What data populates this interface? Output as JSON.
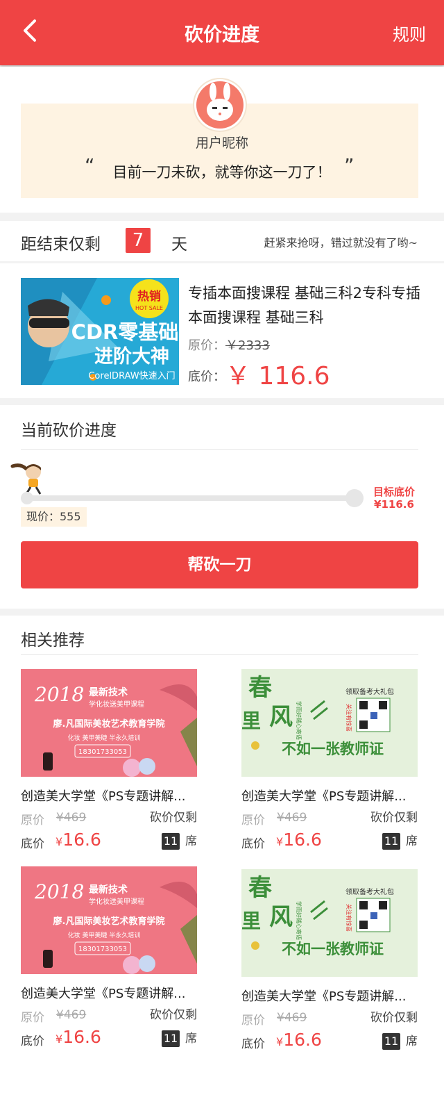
{
  "header": {
    "title": "砍价进度",
    "rules_label": "规则"
  },
  "user": {
    "nickname": "用户昵称",
    "slogan": "目前一刀未砍，就等你这一刀了！",
    "quote_open": "“",
    "quote_close": "”"
  },
  "timer": {
    "label": "距结束仅剩",
    "days": "7",
    "unit": "天",
    "hurry_text": "赶紧来抢呀，错过就没有了哟~"
  },
  "product": {
    "title": "专插本面搜课程 基础三科2专科专插本面搜课程  基础三科",
    "orig_label": "原价：",
    "orig_price": "￥2333",
    "floor_label": "底价：",
    "floor_price": "￥ 116.6",
    "image": {
      "badge_top": "热销",
      "badge_bottom": "HOT SALE",
      "line1": "CDR零基础",
      "line2": "进阶大神",
      "line3": "CorelDRAW快速入门"
    }
  },
  "progress": {
    "title": "当前砍价进度",
    "target_label": "目标底价",
    "target_price": "¥116.6",
    "current_price": "现价：555",
    "progress_fraction": 0,
    "cta_label": "帮砍一刀"
  },
  "recommend": {
    "title": "相关推荐",
    "items": [
      {
        "image": "pink",
        "name": "创造美大学堂《PS专题讲解...",
        "orig_label": "原价",
        "orig_price": "¥469",
        "floor_label": "底价",
        "floor_currency": "¥",
        "floor_price": "16.6",
        "remain_label": "砍价仅剩",
        "seats": "11",
        "seat_unit": "席"
      },
      {
        "image": "green",
        "name": "创造美大学堂《PS专题讲解...",
        "orig_label": "原价",
        "orig_price": "¥469",
        "floor_label": "底价",
        "floor_currency": "¥",
        "floor_price": "16.6",
        "remain_label": "砍价仅剩",
        "seats": "11",
        "seat_unit": "席"
      },
      {
        "image": "pink",
        "name": "创造美大学堂《PS专题讲解...",
        "orig_label": "原价",
        "orig_price": "¥469",
        "floor_label": "底价",
        "floor_currency": "¥",
        "floor_price": "16.6",
        "remain_label": "砍价仅剩",
        "seats": "11",
        "seat_unit": "席"
      },
      {
        "image": "green",
        "name": "创造美大学堂《PS专题讲解...",
        "orig_label": "原价",
        "orig_price": "¥469",
        "floor_label": "底价",
        "floor_currency": "¥",
        "floor_price": "16.6",
        "remain_label": "砍价仅剩",
        "seats": "11",
        "seat_unit": "席"
      }
    ],
    "pink_image": {
      "year": "2018",
      "tag1": "最新技术",
      "tag2": "学化妆送美甲课程",
      "school": "廖.凡国际美妆艺术教育学院",
      "courses": "化妆 美甲美睫 半永久培训",
      "phone": "18301733053"
    },
    "green_image": {
      "big1": "春",
      "big2": "风",
      "big3": "里",
      "slogan": "不如一张教师证",
      "gift": "领取备考大礼包",
      "side": "学而好贼心寄语",
      "follow": "关注有惊喜"
    }
  },
  "colors": {
    "brand": "#ef4444",
    "cream": "#fef3e2"
  }
}
